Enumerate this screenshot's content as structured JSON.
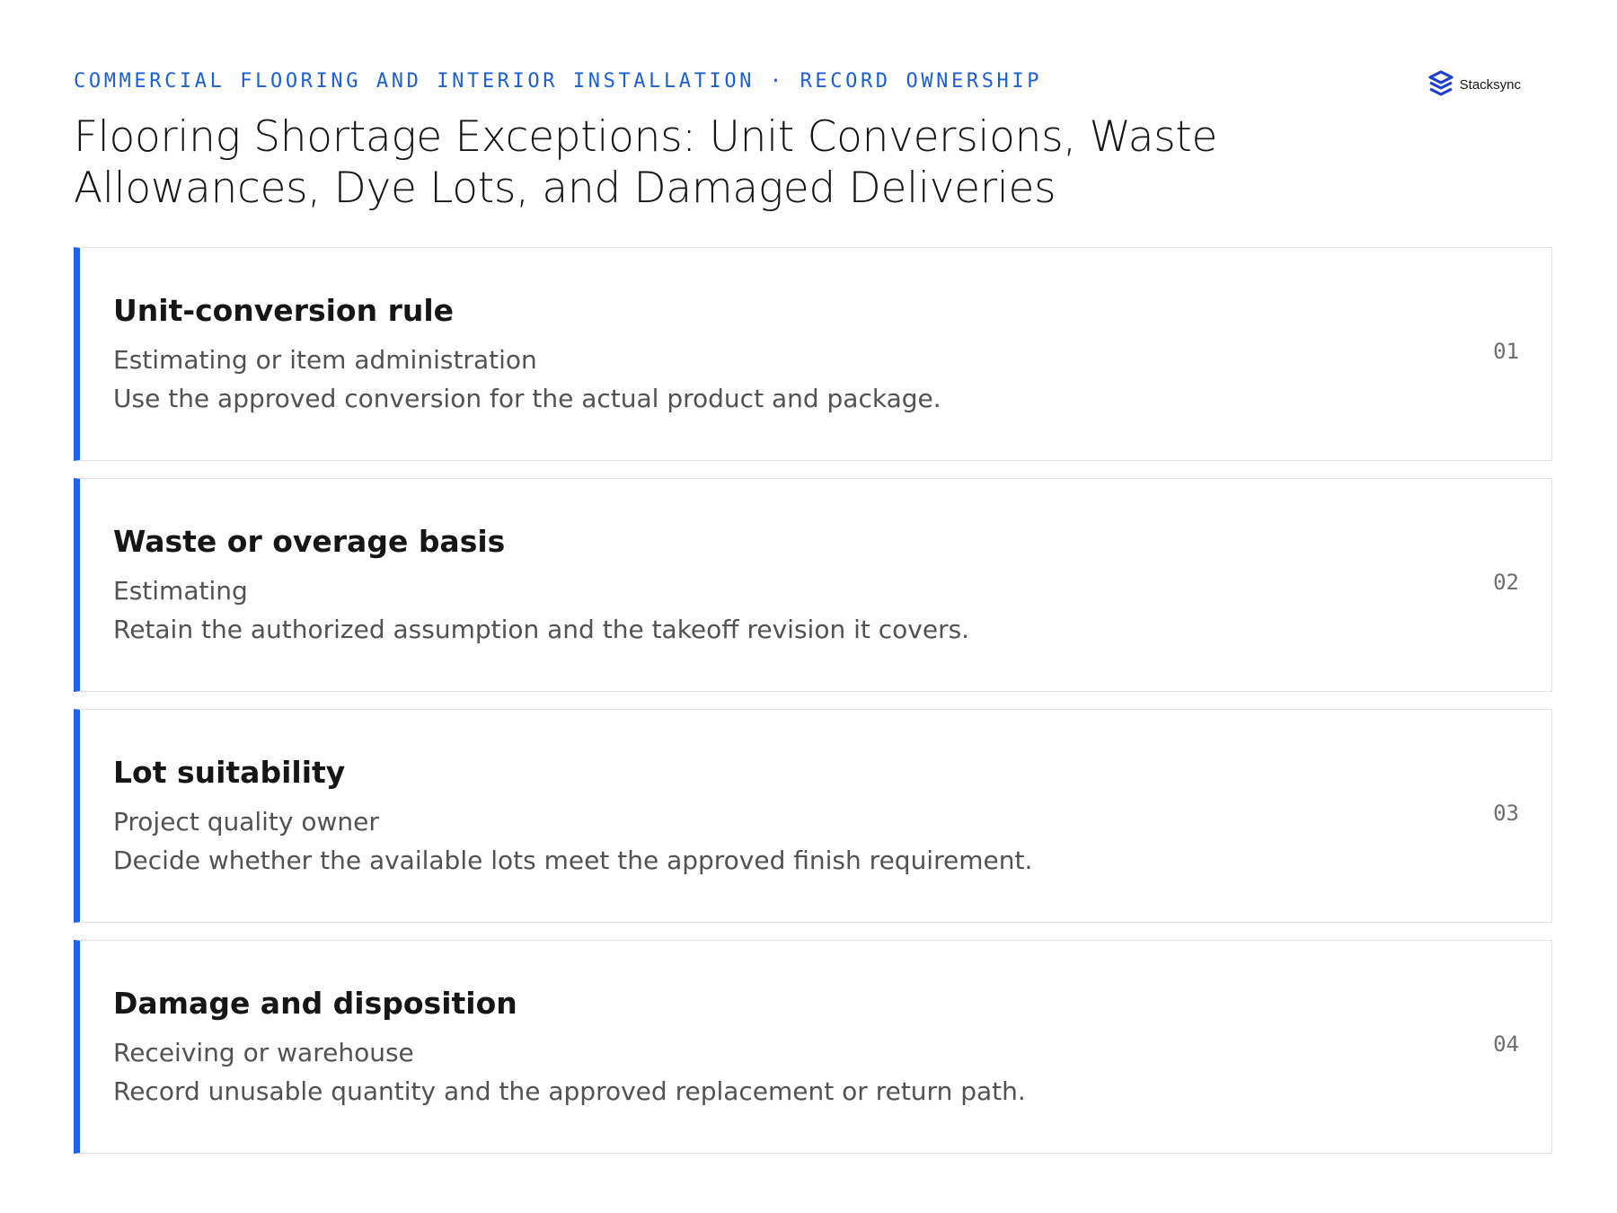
{
  "header": {
    "eyebrow": "COMMERCIAL FLOORING AND INTERIOR INSTALLATION · RECORD OWNERSHIP",
    "title": "Flooring Shortage Exceptions: Unit Conversions, Waste Allowances, Dye Lots, and Damaged Deliveries"
  },
  "brand": {
    "name": "Stacksync",
    "icon": "stacksync-logo-icon",
    "color": "#1f3fd1"
  },
  "colors": {
    "accent": "#1f62f0",
    "eyebrow": "#1b5fd9"
  },
  "rows": [
    {
      "title": "Unit-conversion rule",
      "owner": "Estimating or item administration",
      "description": "Use the approved conversion for the actual product and package.",
      "number": "01"
    },
    {
      "title": "Waste or overage basis",
      "owner": "Estimating",
      "description": "Retain the authorized assumption and the takeoff revision it covers.",
      "number": "02"
    },
    {
      "title": "Lot suitability",
      "owner": "Project quality owner",
      "description": "Decide whether the available lots meet the approved finish requirement.",
      "number": "03"
    },
    {
      "title": "Damage and disposition",
      "owner": "Receiving or warehouse",
      "description": "Record unusable quantity and the approved replacement or return path.",
      "number": "04"
    }
  ]
}
